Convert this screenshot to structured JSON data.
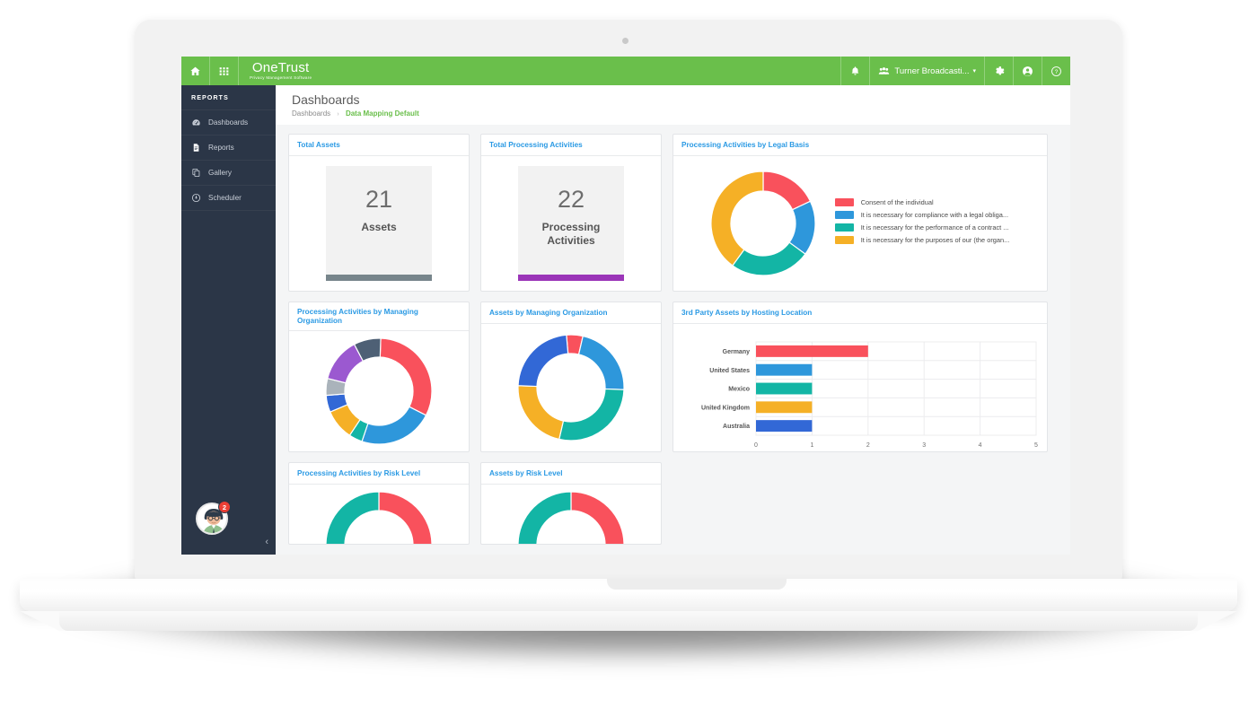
{
  "colors": {
    "brand_green": "#6abf4b",
    "sidebar": "#2b3647",
    "card_title_blue": "#2b9ae4",
    "red": "#f9515c",
    "blue": "#2e97db",
    "teal": "#13b5a5",
    "yellow": "#f5b026",
    "dark_blue": "#3268d6",
    "gray": "#aab3bb",
    "slate": "#4e6075",
    "purple": "#9b59d0",
    "kpi_bar_gray": "#77858b",
    "kpi_bar_purple": "#9b35b8",
    "badge_red": "#ea3f35"
  },
  "topbar": {
    "home_icon": "home-icon",
    "apps_icon": "grid-apps-icon",
    "brand": "OneTrust",
    "tagline": "Privacy Management Software",
    "bell_icon": "bell-icon",
    "org_icon": "people-icon",
    "org_name": "Turner Broadcasti...",
    "org_caret": "chevron-down-icon",
    "gear_icon": "gear-icon",
    "account_icon": "account-circle-icon",
    "help_icon": "help-circle-icon"
  },
  "sidebar": {
    "section_title": "REPORTS",
    "items": [
      {
        "label": "Dashboards",
        "icon": "dashboard-gauge-icon"
      },
      {
        "label": "Reports",
        "icon": "document-icon"
      },
      {
        "label": "Gallery",
        "icon": "copy-layers-icon"
      },
      {
        "label": "Scheduler",
        "icon": "clock-icon"
      }
    ],
    "avatar": "user-avatar",
    "notification_count": "2",
    "collapse_icon": "chevron-left-icon"
  },
  "page": {
    "title": "Dashboards",
    "breadcrumb": {
      "root": "Dashboards",
      "separator": "›",
      "current": "Data Mapping Default"
    }
  },
  "cards": {
    "total_assets": {
      "title": "Total Assets",
      "value": "21",
      "label": "Assets",
      "bar_color": "#77858b"
    },
    "total_processing": {
      "title": "Total Processing Activities",
      "value": "22",
      "label": "Processing Activities",
      "bar_color": "#9b35b8"
    },
    "legal_basis": {
      "title": "Processing Activities by Legal Basis"
    },
    "pa_managing_org": {
      "title": "Processing Activities by Managing Organization"
    },
    "assets_managing_org": {
      "title": "Assets by Managing Organization"
    },
    "third_party": {
      "title": "3rd Party Assets by Hosting Location"
    },
    "pa_risk": {
      "title": "Processing Activities by Risk Level"
    },
    "assets_risk": {
      "title": "Assets by Risk Level"
    }
  },
  "chart_data": [
    {
      "type": "pie",
      "id": "processing-activities-by-legal-basis",
      "title": "Processing Activities by Legal Basis",
      "legend_position": "right",
      "labels": [
        "Consent of the individual",
        "It is necessary for compliance with a legal obliga...",
        "It is necessary for the performance of a contract ...",
        "It is necessary for the purposes of our (the organ..."
      ],
      "values": [
        18,
        17,
        25,
        40
      ],
      "colors": [
        "#f9515c",
        "#2e97db",
        "#13b5a5",
        "#f5b026"
      ]
    },
    {
      "type": "pie",
      "id": "processing-activities-by-managing-organization",
      "title": "Processing Activities by Managing Organization",
      "legend_position": "none",
      "values": [
        31,
        22,
        4,
        9,
        5,
        5,
        13,
        8
      ],
      "colors": [
        "#f9515c",
        "#2e97db",
        "#13b5a5",
        "#f5b026",
        "#3268d6",
        "#aab3bb",
        "#9b59d0",
        "#4e6075"
      ]
    },
    {
      "type": "pie",
      "id": "assets-by-managing-organization",
      "title": "Assets by Managing Organization",
      "legend_position": "none",
      "values": [
        5,
        22,
        28,
        22,
        23
      ],
      "colors": [
        "#f9515c",
        "#2e97db",
        "#13b5a5",
        "#f5b026",
        "#3268d6"
      ]
    },
    {
      "type": "bar",
      "id": "3rd-party-assets-by-hosting-location",
      "title": "3rd Party Assets by Hosting Location",
      "orientation": "horizontal",
      "categories": [
        "Germany",
        "United States",
        "Mexico",
        "United Kingdom",
        "Australia"
      ],
      "values": [
        2,
        1,
        1,
        1,
        1
      ],
      "colors": [
        "#f9515c",
        "#2e97db",
        "#13b5a5",
        "#f5b026",
        "#3268d6"
      ],
      "xlabel": "",
      "ylabel": "",
      "xlim": [
        0,
        5
      ],
      "xticks": [
        "0",
        "1",
        "2",
        "3",
        "4",
        "5"
      ],
      "grid": true
    },
    {
      "type": "pie",
      "id": "processing-activities-by-risk-level",
      "title": "Processing Activities by Risk Level",
      "legend_position": "none",
      "values": [
        50,
        50
      ],
      "colors": [
        "#f9515c",
        "#13b5a5"
      ]
    },
    {
      "type": "pie",
      "id": "assets-by-risk-level",
      "title": "Assets by Risk Level",
      "legend_position": "none",
      "values": [
        50,
        50
      ],
      "colors": [
        "#f9515c",
        "#13b5a5"
      ]
    }
  ]
}
